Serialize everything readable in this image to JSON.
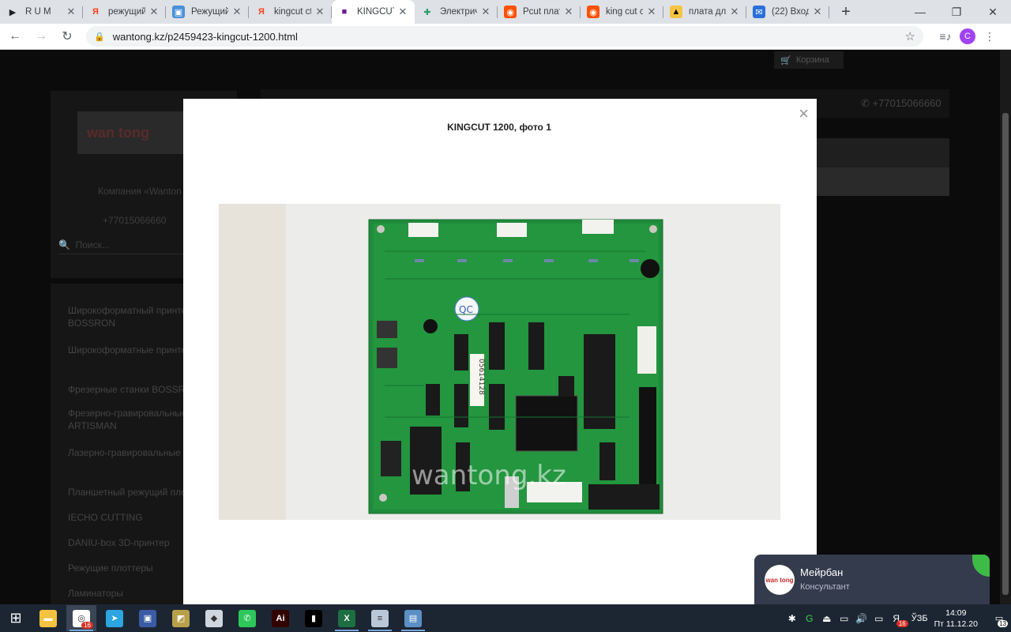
{
  "tabs": [
    {
      "title": "R U M",
      "fav": "▶",
      "color": "#202124",
      "bg": "transparent"
    },
    {
      "title": "режущий",
      "fav": "Я",
      "color": "#fc3f1d",
      "bg": "transparent"
    },
    {
      "title": "Режущий",
      "fav": "▣",
      "color": "#ffffff",
      "bg": "#4a90d9"
    },
    {
      "title": "kingcut ct",
      "fav": "Я",
      "color": "#fc3f1d",
      "bg": "transparent"
    },
    {
      "title": "KINGCUT",
      "fav": "■",
      "color": "#6a1b9a",
      "bg": "transparent"
    },
    {
      "title": "Электрич",
      "fav": "✚",
      "color": "#2e9e6a",
      "bg": "transparent"
    },
    {
      "title": "Pcut плата",
      "fav": "◉",
      "color": "#ffffff",
      "bg": "#ff5000"
    },
    {
      "title": "king cut ct",
      "fav": "◉",
      "color": "#ffffff",
      "bg": "#ff5000"
    },
    {
      "title": "плата для",
      "fav": "▲",
      "color": "#000000",
      "bg": "#f6c342"
    },
    {
      "title": "(22) Входя",
      "fav": "✉",
      "color": "#ffffff",
      "bg": "#2a6fdb"
    }
  ],
  "url": "wantong.kz/p2459423-kingcut-1200.html",
  "avatar_letter": "C",
  "page": {
    "cart": "Корзина",
    "company": "Компания «Wanton",
    "phone_left": "+77015066660",
    "search_placeholder": "Поиск...",
    "phone_right": "+77015066660",
    "logo_text": "wan tong",
    "menu": [
      "Широкоформатный принте BOSSRON",
      "Широкоформатные принте ACME",
      "Фрезерные станки BOSSRO",
      "Фрезерно-гравировальные станки ARTISMAN",
      "Лазерно-гравировальные станки",
      "Планшетный режущий пло",
      "IECHO CUTTING",
      "DANIU-box 3D-принтер",
      "Режущие плоттеры",
      "Ламинаторы"
    ]
  },
  "modal": {
    "title": "KINGCUT 1200, фото 1",
    "close": "×",
    "watermark": "wantong.kz",
    "board_text": {
      "qc": "QC",
      "serial": "05614128"
    }
  },
  "chat": {
    "name": "Мейрбан",
    "role": "Консультант",
    "avatar_text": "wan tong"
  },
  "taskbar": {
    "apps": [
      {
        "name": "file-explorer",
        "glyph": "▬",
        "bg": "#f3c341",
        "running": false
      },
      {
        "name": "chrome",
        "glyph": "◎",
        "bg": "#ffffff",
        "running": true,
        "active": true,
        "badge": "16"
      },
      {
        "name": "telegram",
        "glyph": "➤",
        "bg": "#2ca5e0",
        "running": false
      },
      {
        "name": "save-disk",
        "glyph": "▣",
        "bg": "#3b5ba5",
        "running": false
      },
      {
        "name": "photo-viewer",
        "glyph": "◩",
        "bg": "#b8a04a",
        "running": false
      },
      {
        "name": "paint",
        "glyph": "◆",
        "bg": "#d0d6de",
        "running": false
      },
      {
        "name": "phone-link",
        "glyph": "✆",
        "bg": "#2ec75a",
        "running": false
      },
      {
        "name": "illustrator",
        "glyph": "Ai",
        "bg": "#330000",
        "running": false
      },
      {
        "name": "terminal",
        "glyph": "▮",
        "bg": "#000000",
        "running": false
      },
      {
        "name": "excel",
        "glyph": "X",
        "bg": "#1d6f42",
        "running": true
      },
      {
        "name": "notepad",
        "glyph": "≡",
        "bg": "#b9c7d9",
        "running": true
      },
      {
        "name": "explorer-window",
        "glyph": "▤",
        "bg": "#5b8fc5",
        "running": true
      }
    ],
    "lang": "ЎЗБ",
    "time": "14:09",
    "date": "Пт 11.12.20",
    "yandex_badge": "16",
    "notif_count": "13"
  }
}
